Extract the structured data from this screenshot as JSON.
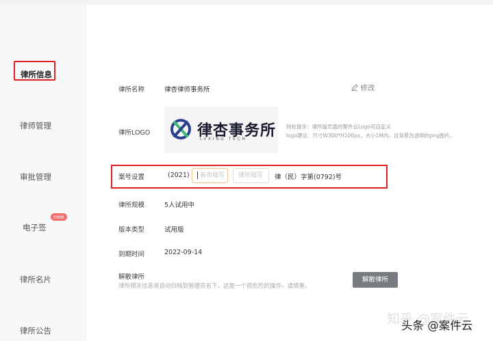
{
  "sidebar": {
    "items": [
      {
        "label": "律所信息"
      },
      {
        "label": "律师管理"
      },
      {
        "label": "审批管理"
      },
      {
        "label": "电子签",
        "badge": "new"
      },
      {
        "label": "律所名片"
      },
      {
        "label": "律所公告"
      }
    ]
  },
  "form": {
    "name_label": "律所名称",
    "name_value": "律杏律师事务所",
    "edit_label": "修改",
    "logo_label": "律所LOGO",
    "logo_text_cn": "律杏事务所",
    "logo_text_en": "LVXING TECH",
    "logo_hint_1": "特权提示：律所版页面的案件云Logo可自定义",
    "logo_hint_2": "logo建议：尺寸W300*H100px，大小1M内，且背景为透明的png图片。",
    "case_label": "案号设置",
    "case_year": "(2021)",
    "case_input1_placeholder": "省市缩写",
    "case_input2_placeholder": "律所缩写",
    "case_mid": "律（民）字第",
    "case_number": "(0792)",
    "case_suffix": "号",
    "scale_label": "律所规模",
    "scale_value": "5人试用中",
    "version_label": "版本类型",
    "version_value": "试用版",
    "expire_label": "到期时间",
    "expire_value": "2022-09-14",
    "dissolve_label": "解散律所",
    "dissolve_desc": "律所相关信息将自动归档到管理员名下，这是一个很危险的操作，请慎重。",
    "dissolve_button": "解散律所"
  },
  "watermark": {
    "zhihu": "知乎 @案件云",
    "toutiao": "头条 @案件云"
  },
  "colors": {
    "highlight_red": "#e02020",
    "badge_red": "#f56c6c",
    "button_gray": "#777b80",
    "logo_blue": "#2b3f8f",
    "logo_green": "#3cb878"
  }
}
